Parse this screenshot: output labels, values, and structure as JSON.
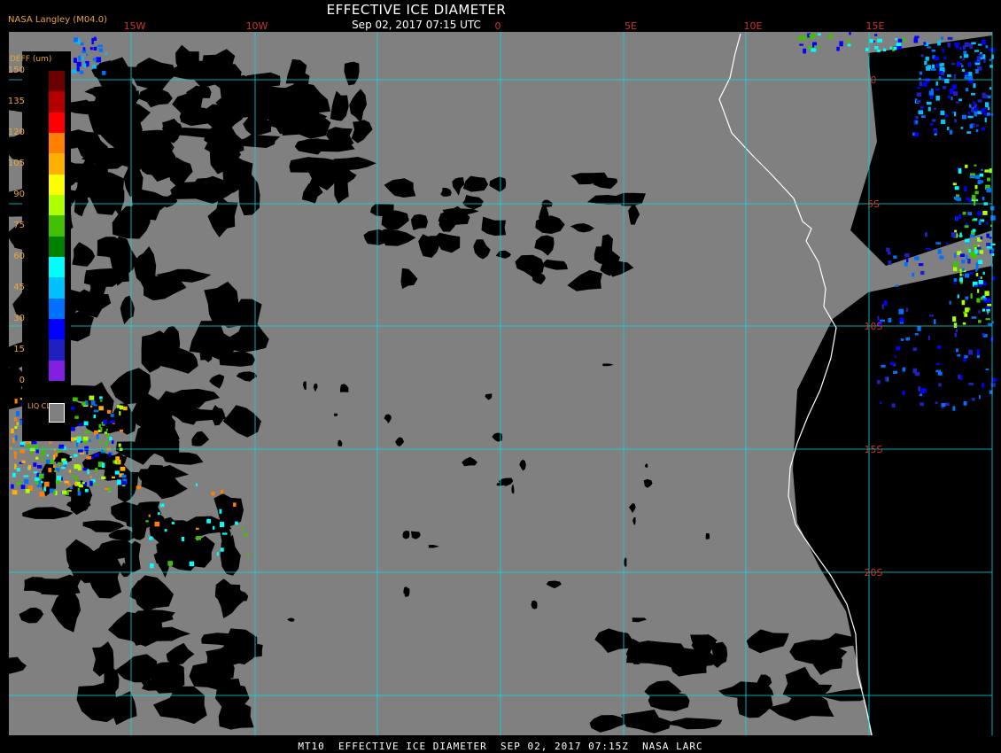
{
  "title": "EFFECTIVE ICE DIAMETER",
  "subtitle": "Sep 02, 2017 07:15 UTC",
  "org_label": "NASA Langley (M04.0)",
  "footer": "MT10  EFFECTIVE ICE DIAMETER  SEP 02, 2017 07:15Z  NASA LARC",
  "colors": {
    "background": "#000000",
    "clear_sky": "#000000",
    "liquid_cloud": "#808080",
    "grid": "#00e0e0",
    "coastline": "#ffffff",
    "label": "#e8a53c",
    "grid_label": "#d03030"
  },
  "longitude_labels": [
    "15W",
    "10W",
    "0",
    "5E",
    "10E",
    "15E"
  ],
  "latitude_labels": [
    "0",
    "5S",
    "10S",
    "15S",
    "20S"
  ],
  "legend": {
    "title": "DEFF (um)",
    "ticks": [
      "150",
      "135",
      "120",
      "105",
      "90",
      "75",
      "60",
      "45",
      "30",
      "15",
      "0"
    ],
    "colors": [
      "#6b0000",
      "#b20000",
      "#ff0000",
      "#ff7f00",
      "#ffb000",
      "#ffff00",
      "#b0ff00",
      "#40c000",
      "#008000",
      "#00ffff",
      "#00c0ff",
      "#0070ff",
      "#0000ff",
      "#2020c0",
      "#8020e0"
    ],
    "liquid_label": "LIQ CLD"
  }
}
